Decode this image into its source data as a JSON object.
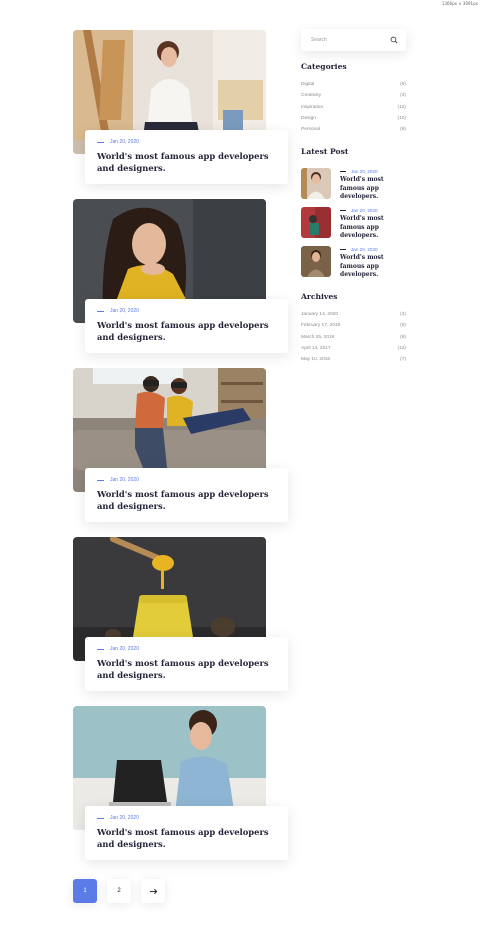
{
  "dimension_label": "1366px × 3091px",
  "posts": [
    {
      "date": "Jan 20, 2020",
      "title": "World's most famous app developers and designers.",
      "image": "woman-painting"
    },
    {
      "date": "Jan 20, 2020",
      "title": "World's most famous app developers and designers.",
      "image": "woman-yellow-sweater"
    },
    {
      "date": "Jan 20, 2020",
      "title": "World's most famous app developers and designers.",
      "image": "couple-vr-sofa"
    },
    {
      "date": "Jan 20, 2020",
      "title": "World's most famous app developers and designers.",
      "image": "honey-pot"
    },
    {
      "date": "Jan 20, 2020",
      "title": "World's most famous app developers and designers.",
      "image": "woman-laptop"
    }
  ],
  "pagination": {
    "pages": [
      "1",
      "2"
    ],
    "active": "1",
    "next_icon": "arrow-right-icon"
  },
  "search": {
    "placeholder": "Search",
    "icon": "search-icon"
  },
  "categories": {
    "heading": "Categories",
    "items": [
      {
        "name": "Digital",
        "count": "(6)"
      },
      {
        "name": "Creativity",
        "count": "(3)"
      },
      {
        "name": "Inspiration",
        "count": "(12)"
      },
      {
        "name": "Design",
        "count": "(10)"
      },
      {
        "name": "Personal",
        "count": "(6)"
      }
    ]
  },
  "latest": {
    "heading": "Latest Post",
    "items": [
      {
        "date": "Jan 20, 2020",
        "title": "World's most famous app developers."
      },
      {
        "date": "Jan 20, 2020",
        "title": "World's most famous app developers."
      },
      {
        "date": "Jan 20, 2020",
        "title": "World's most famous app developers."
      }
    ]
  },
  "archives": {
    "heading": "Archives",
    "items": [
      {
        "name": "January 14, 2020",
        "count": "(3)"
      },
      {
        "name": "February 17, 2019",
        "count": "(6)"
      },
      {
        "name": "March 25, 2018",
        "count": "(8)"
      },
      {
        "name": "April 14, 2017",
        "count": "(12)"
      },
      {
        "name": "May 10, 2016",
        "count": "(7)"
      }
    ]
  },
  "colors": {
    "accent": "#5b7be6",
    "heading": "#23243a",
    "muted": "#8a8a8a"
  }
}
